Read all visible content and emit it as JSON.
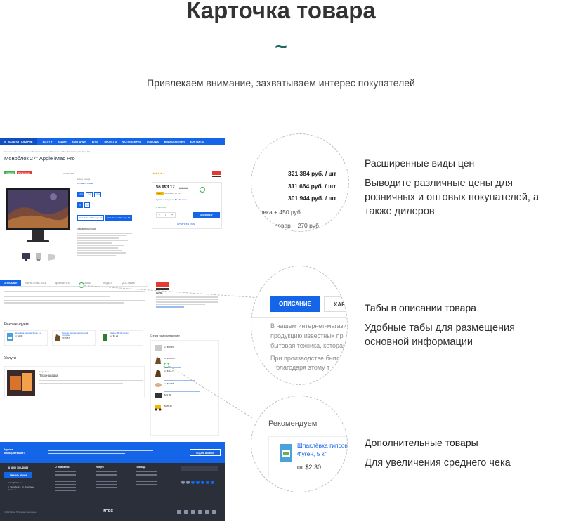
{
  "hero": {
    "title": "Карточка товара",
    "tilde": "~",
    "subtitle": "Привлекаем внимание, захватываем интерес покупателей"
  },
  "screenshot": {
    "nav": {
      "catalog": "КАТАЛОГ ТОВАРОВ",
      "items": [
        "УСЛУГИ",
        "АКЦИИ",
        "КОМПАНИЯ",
        "БЛОГ",
        "ПРОЕКТЫ",
        "ФОТОГАЛЕРЕЯ",
        "ПОМОЩЬ",
        "ВИДЕОГАЛЕРЕЯ",
        "КОНТАКТЫ"
      ]
    },
    "breadcrumbs": "Главная / Каталог товаров / Бытовая техника / Мониторы / Моноблок 27\" Apple iMac Pro",
    "product_title": "Моноблок 27\" Apple iMac Pro",
    "badges": [
      "Новинка",
      "Распродажа"
    ],
    "compare": "СРАВНИТЬ",
    "price": "$6 993.17",
    "old_price": "$29 158",
    "discount": "-10%",
    "saving": "Экономия $1 100",
    "in_stock": "В наличии",
    "buy_button": "В КОРЗИНУ",
    "quick_order": "КУПИТЬ В 1 КЛИК",
    "credit": "Купить в кредит за $2 170 / мес",
    "qty": "1",
    "options": [
      "21.5",
      "24",
      "27.5",
      "24",
      "27"
    ],
    "mod_options": [
      "Intel Radeon Pro Vega 56",
      "Intel Radeon Pro Vega 64"
    ],
    "spec_title": "Характеристики",
    "tabs": [
      "ОПИСАНИЕ",
      "ХАРАКТЕРИСТИКИ",
      "ДОКУМЕНТЫ",
      "ОТЗЫВЫ",
      "ВИДЕО",
      "ДОСТАВКА"
    ],
    "brand": "ZAZOL",
    "recommend_title": "Рекомендуем",
    "recommend_items": [
      {
        "name": "Шпаклёвка гипсовая Фуген, 5 кг",
        "price": "от $2.30"
      },
      {
        "name": "Ботинки рабочие на сплошной подошве",
        "price": "$155.67"
      },
      {
        "name": "Эмаль ПФ-115 белая",
        "price": "от $3.22"
      }
    ],
    "also_title": "С этим товаром покупают",
    "also_items": [
      {
        "price": "от $98.25"
      },
      {
        "price": "от $398.08"
      },
      {
        "price": "от $118.71"
      },
      {
        "price": "от $33.38"
      },
      {
        "price": "$49.89"
      },
      {
        "price": "$286.32"
      }
    ],
    "services_title": "Услуги",
    "service": {
      "tag": "Подробнее",
      "name": "Пусконаладка"
    },
    "footer": {
      "subscribe_title": "Нужна консультация?",
      "subscribe_btn": "ЗАДАТЬ ВОПРОС",
      "phone": "8 (800) 100-40-85",
      "callback": "Заказать звонок",
      "email": "sale@intec.ru",
      "address": "г. Челябинск, ул. Свободы, 2, оф. 1",
      "cols": [
        "О компании",
        "Услуги",
        "Помощь"
      ],
      "copyright": "© 2021 Intec. Все права защищены",
      "logo": "INTEC"
    }
  },
  "callouts": {
    "prices": [
      "321 384 руб. / шт",
      "311 664 руб. / шт",
      "301 944 руб. / шт"
    ],
    "price_tail1": "ковка + 450 руб.",
    "price_tail2": "ия на товар + 270 руб.",
    "tab_active": "ОПИСАНИЕ",
    "tab_next": "ХАР",
    "tab_text1": "В нашем интернет-магази",
    "tab_text2": "продукцию известных пр",
    "tab_text3": "бытовая техника, которая",
    "tab_text4": "При производстве быто",
    "tab_text5": "благодаря этому т",
    "rec_title": "Рекомендуем",
    "rec_name1": "Шпаклёвка гипсов",
    "rec_name2": "Фуген, 5 кг",
    "rec_price": "от $2.30"
  },
  "features": [
    {
      "title": "Расширенные виды цен",
      "text": "Выводите различные цены для розничных и оптовых покупателей, а также дилеров"
    },
    {
      "title": "Табы в описании товара",
      "text": "Удобные табы для размещения основной информации"
    },
    {
      "title": "Дополнительные товары",
      "text": "Для увеличения среднего чека"
    }
  ]
}
